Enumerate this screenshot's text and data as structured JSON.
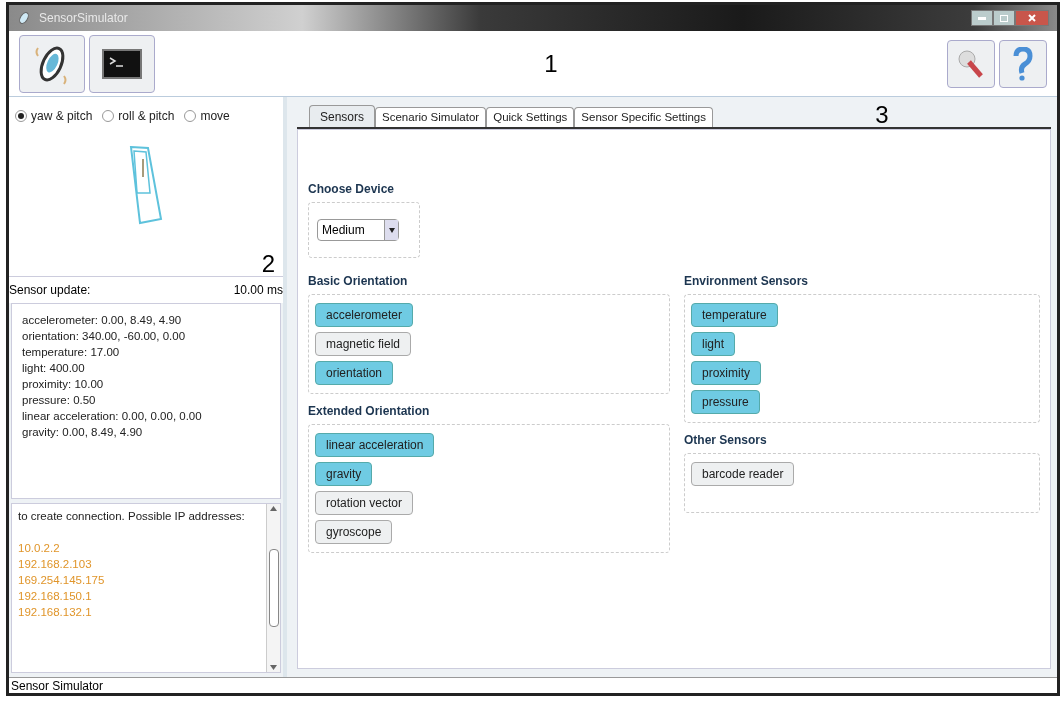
{
  "window": {
    "title": "SensorSimulator"
  },
  "toolbar": {
    "callout": "1"
  },
  "device_view": {
    "modes": [
      {
        "label": "yaw & pitch",
        "selected": true
      },
      {
        "label": "roll & pitch",
        "selected": false
      },
      {
        "label": "move",
        "selected": false
      }
    ],
    "callout": "2"
  },
  "sensor_update": {
    "label": "Sensor update:",
    "value": "10.00 ms"
  },
  "readings": [
    "accelerometer: 0.00, 8.49, 4.90",
    "orientation: 340.00, -60.00, 0.00",
    "temperature: 17.00",
    "light: 400.00",
    "proximity: 10.00",
    "pressure: 0.50",
    "linear acceleration: 0.00, 0.00, 0.00",
    "gravity: 0.00, 8.49, 4.90"
  ],
  "log": {
    "message": "to create connection. Possible IP addresses:",
    "addresses": [
      "10.0.2.2",
      "192.168.2.103",
      "169.254.145.175",
      "192.168.150.1",
      "192.168.132.1"
    ]
  },
  "tabs": [
    {
      "label": "Sensors",
      "selected": true
    },
    {
      "label": "Scenario Simulator",
      "selected": false
    },
    {
      "label": "Quick Settings",
      "selected": false
    },
    {
      "label": "Sensor Specific Settings",
      "selected": false
    }
  ],
  "tabs_callout": "3",
  "choose_device": {
    "label": "Choose Device",
    "value": "Medium"
  },
  "left_groups": [
    {
      "title": "Basic Orientation",
      "sensors": [
        {
          "label": "accelerometer",
          "on": true
        },
        {
          "label": "magnetic field",
          "on": false
        },
        {
          "label": "orientation",
          "on": true
        }
      ]
    },
    {
      "title": "Extended Orientation",
      "sensors": [
        {
          "label": "linear acceleration",
          "on": true
        },
        {
          "label": "gravity",
          "on": true
        },
        {
          "label": "rotation vector",
          "on": false
        },
        {
          "label": "gyroscope",
          "on": false
        }
      ]
    }
  ],
  "right_groups": [
    {
      "title": "Environment Sensors",
      "sensors": [
        {
          "label": "temperature",
          "on": true
        },
        {
          "label": "light",
          "on": true
        },
        {
          "label": "proximity",
          "on": true
        },
        {
          "label": "pressure",
          "on": true
        }
      ]
    },
    {
      "title": "Other Sensors",
      "sensors": [
        {
          "label": "barcode reader",
          "on": false
        }
      ]
    }
  ],
  "status_bar": "Sensor Simulator"
}
